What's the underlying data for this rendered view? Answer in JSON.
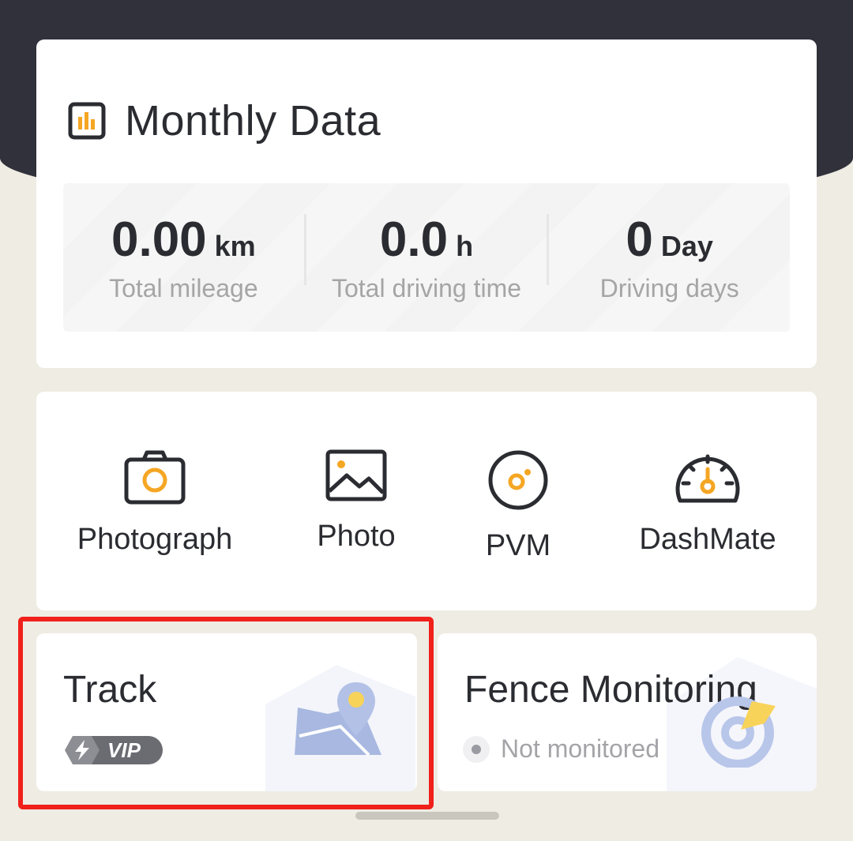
{
  "monthly": {
    "title": "Monthly Data",
    "icon": "bar-chart-icon",
    "stats": [
      {
        "value": "0.00",
        "unit": "km",
        "label": "Total mileage"
      },
      {
        "value": "0.0",
        "unit": "h",
        "label": "Total driving time"
      },
      {
        "value": "0",
        "unit": "Day",
        "label": "Driving days"
      }
    ]
  },
  "tools": [
    {
      "label": "Photograph",
      "icon": "camera-icon"
    },
    {
      "label": "Photo",
      "icon": "image-icon"
    },
    {
      "label": "PVM",
      "icon": "pvm-icon"
    },
    {
      "label": "DashMate",
      "icon": "speedometer-icon"
    }
  ],
  "track": {
    "title": "Track",
    "badge": "VIP",
    "icon": "map-pin-icon"
  },
  "fence": {
    "title": "Fence Monitoring",
    "status": "Not monitored",
    "icon": "target-icon"
  },
  "colors": {
    "accent": "#f5a623",
    "dark": "#30313b",
    "background": "#efece3",
    "highlight": "#f0201b"
  }
}
